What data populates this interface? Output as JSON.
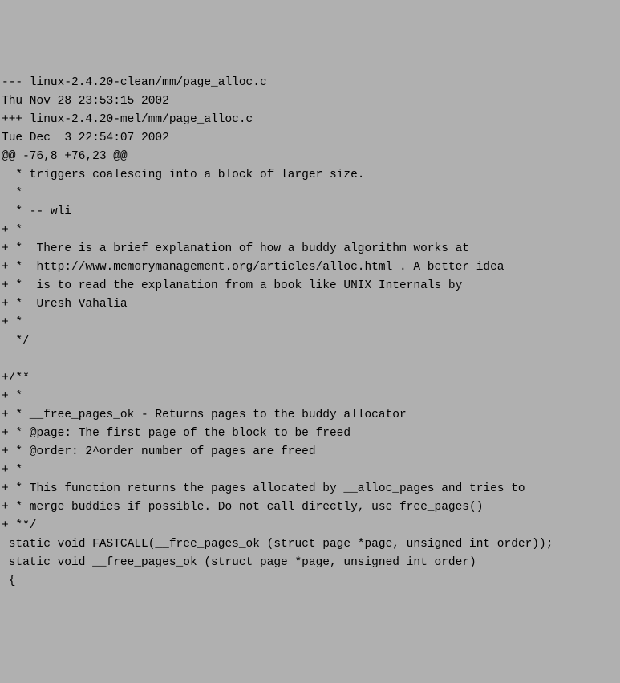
{
  "lines": [
    "--- linux-2.4.20-clean/mm/page_alloc.c",
    "Thu Nov 28 23:53:15 2002",
    "+++ linux-2.4.20-mel/mm/page_alloc.c",
    "Tue Dec  3 22:54:07 2002",
    "@@ -76,8 +76,23 @@",
    "  * triggers coalescing into a block of larger size.",
    "  *",
    "  * -- wli",
    "+ *",
    "+ *  There is a brief explanation of how a buddy algorithm works at",
    "+ *  http://www.memorymanagement.org/articles/alloc.html . A better idea",
    "+ *  is to read the explanation from a book like UNIX Internals by",
    "+ *  Uresh Vahalia",
    "+ *",
    "  */",
    "",
    "+/**",
    "+ *",
    "+ * __free_pages_ok - Returns pages to the buddy allocator",
    "+ * @page: The first page of the block to be freed",
    "+ * @order: 2^order number of pages are freed",
    "+ *",
    "+ * This function returns the pages allocated by __alloc_pages and tries to",
    "+ * merge buddies if possible. Do not call directly, use free_pages()",
    "+ **/",
    " static void FASTCALL(__free_pages_ok (struct page *page, unsigned int order));",
    " static void __free_pages_ok (struct page *page, unsigned int order)",
    " {"
  ]
}
